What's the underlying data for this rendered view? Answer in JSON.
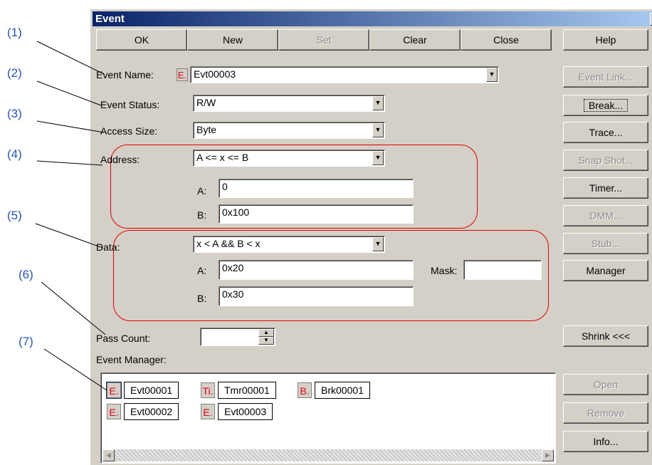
{
  "callouts": [
    "(1)",
    "(2)",
    "(3)",
    "(4)",
    "(5)",
    "(6)",
    "(7)"
  ],
  "window": {
    "title": "Event",
    "close_glyph": "×"
  },
  "toolbar": {
    "ok": "OK",
    "new": "New",
    "set": "Set",
    "clear": "Clear",
    "close": "Close",
    "help": "Help"
  },
  "form": {
    "event_name_label": "Event Name:",
    "event_badge": "E.",
    "event_name_value": "Evt00003",
    "event_status_label": "Event Status:",
    "event_status_value": "R/W",
    "access_size_label": "Access Size:",
    "access_size_value": "Byte",
    "address_label": "Address:",
    "address_condition": "A <= x <= B",
    "address_a_label": "A:",
    "address_a_value": "0",
    "address_b_label": "B:",
    "address_b_value": "0x100",
    "data_label": "Data:",
    "data_condition": "x < A && B < x",
    "data_a_label": "A:",
    "data_a_value": "0x20",
    "data_b_label": "B:",
    "data_b_value": "0x30",
    "mask_label": "Mask:",
    "mask_value": "",
    "pass_count_label": "Pass Count:",
    "pass_count_value": "",
    "event_manager_label": "Event Manager:"
  },
  "side_buttons": {
    "event_link": "Event Link...",
    "break": "Break...",
    "trace": "Trace...",
    "snap_shot": "Snap Shot...",
    "timer": "Timer...",
    "dmm": "DMM...",
    "stub": "Stub...",
    "manager": "Manager",
    "shrink": "Shrink <<<",
    "open": "Open",
    "remove": "Remove",
    "info": "Info..."
  },
  "event_manager": {
    "row1": [
      {
        "badge": "E.",
        "name": "Evt00001"
      },
      {
        "badge": "Ti.",
        "name": "Tmr00001"
      },
      {
        "badge": "B.",
        "name": "Brk00001"
      }
    ],
    "row2": [
      {
        "badge": "E.",
        "name": "Evt00002"
      },
      {
        "badge": "E.",
        "name": "Evt00003"
      }
    ]
  },
  "scroll_glyphs": {
    "left": "◀",
    "right": "▶"
  },
  "colors": {
    "callout": "#2255cc",
    "highlight": "#e00000",
    "badge_text": "#e0001a",
    "titlebar": "#0a246a"
  }
}
